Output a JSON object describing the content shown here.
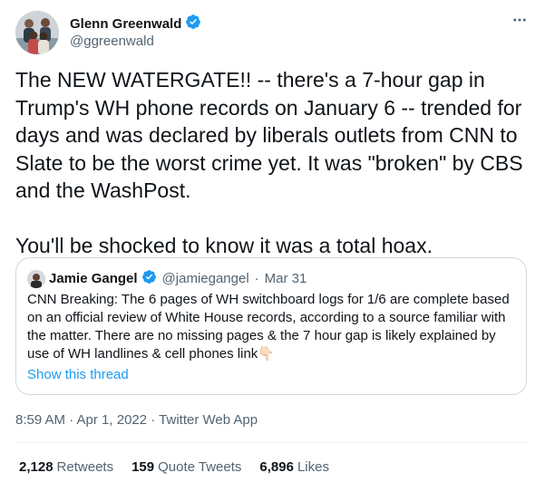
{
  "author": {
    "display_name": "Glenn Greenwald",
    "handle": "@ggreenwald",
    "verified": true
  },
  "tweet": {
    "text": "The NEW WATERGATE!! -- there's a 7-hour gap in Trump's WH phone records on January 6 -- trended for days and was declared by liberals outlets from CNN to Slate to be the worst crime yet. It was \"broken\" by CBS and the WashPost.\n\nYou'll be shocked to know it was a total hoax."
  },
  "quoted_tweet": {
    "display_name": "Jamie Gangel",
    "handle": "@jamiegangel",
    "separator": "·",
    "date": "Mar 31",
    "text": "CNN Breaking: The 6 pages of WH switchboard logs for 1/6 are complete based on an official review of White House records, according to a source familiar with the matter. There are no missing pages & the 7 hour gap is likely explained by use of WH landlines & cell phones link",
    "emoji": "👇🏻",
    "show_thread_label": "Show this thread"
  },
  "meta": {
    "timestamp": "8:59 AM · Apr 1, 2022 · Twitter Web App"
  },
  "stats": {
    "retweets_count": "2,128",
    "retweets_label": "Retweets",
    "quotes_count": "159",
    "quotes_label": "Quote Tweets",
    "likes_count": "6,896",
    "likes_label": "Likes"
  },
  "colors": {
    "accent": "#1d9bf0",
    "text_primary": "#0f1419",
    "text_secondary": "#536471",
    "border": "#cfd9de"
  },
  "icons": {
    "verified": "verified-badge-icon",
    "more": "more-horizontal-icon"
  }
}
